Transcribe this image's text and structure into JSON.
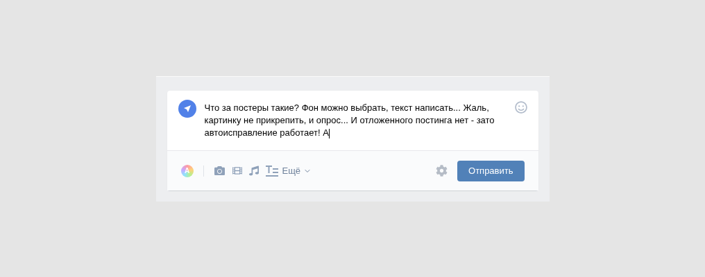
{
  "composer": {
    "text": "Что за постеры такие? Фон можно выбрать, текст написать... Жаль, картинку не прикрепить, и опрос... И отложенного постинга нет - зато автоисправление работает! А",
    "poster_letter": "A",
    "more_label": "Ещё",
    "send_label": "Отправить"
  }
}
